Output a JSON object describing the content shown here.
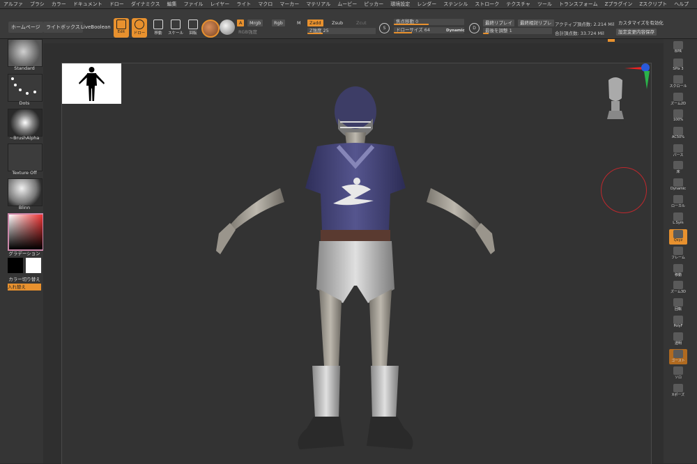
{
  "menu": [
    "アルファ",
    "ブラシ",
    "カラー",
    "ドキュメント",
    "ドロー",
    "ダイナミクス",
    "編集",
    "ファイル",
    "レイヤー",
    "ライト",
    "マクロ",
    "マーカー",
    "マテリアル",
    "ムービー",
    "ピッカー",
    "環境設定",
    "レンダー",
    "ステンシル",
    "ストローク",
    "テクスチャ",
    "ツール",
    "トランスフォーム",
    "Zプラグイン",
    "Zスクリプト",
    "ヘルプ"
  ],
  "shelf": {
    "home": "ホームページ",
    "lightbox": "ライトボックス",
    "liveboolean": "LiveBoolean"
  },
  "tools": {
    "edit": "Edit",
    "draw": "ドロー",
    "move": "移動",
    "scale": "スケール",
    "rotate": "回転"
  },
  "material_mode": {
    "a": "A",
    "mrgb": "Mrgb",
    "rgb": "Rgb",
    "m": "M",
    "rgb_intensity": "RGB強度"
  },
  "z_mode": {
    "zadd": "Zadd",
    "zsub": "Zsub",
    "zcut": "Zcut",
    "z_intensity": "Z強度 25"
  },
  "focal": {
    "label": "焦点移動 0"
  },
  "draw_size": {
    "label": "ドローサイズ 64",
    "dynamic": "Dynamic"
  },
  "s_label": "S",
  "d_label": "D",
  "replay": {
    "last": "最終リプレイ",
    "last_rel": "最終相対リプレ",
    "adjust": "最後を調整 1"
  },
  "stats": {
    "active": "アクティブ頂点数: 2.214 Mil",
    "total": "合計頂点数: 33.724 Mil"
  },
  "customize": {
    "enable": "カスタマイズを有効化",
    "save": "設定変更内容保存"
  },
  "left": {
    "brush": "Standard",
    "stroke": "Dots",
    "alpha": "~BrushAlpha",
    "texture": "Texture Off",
    "material": "Blinn",
    "gradient": "グラデーション",
    "switch": "カラー切り替え",
    "swap": "入れ替え"
  },
  "right": [
    {
      "name": "bpr-button",
      "label": "BPR"
    },
    {
      "name": "spix-button",
      "label": "SPix 3"
    },
    {
      "name": "scroll-button",
      "label": "スクロール"
    },
    {
      "name": "zoom2d-button",
      "label": "ズーム2D"
    },
    {
      "name": "zoom100-button",
      "label": "100%"
    },
    {
      "name": "ac50-button",
      "label": "AC50%"
    },
    {
      "name": "perspective-button",
      "label": "パース"
    },
    {
      "name": "floor-button",
      "label": "床"
    },
    {
      "name": "dynamic-button",
      "label": "Dynamic"
    },
    {
      "name": "local-button",
      "label": "ローカル"
    },
    {
      "name": "lsym-button",
      "label": "L.Sym"
    },
    {
      "name": "xyz-button",
      "label": "Qxyz"
    },
    {
      "name": "frame-button",
      "label": "フレーム"
    },
    {
      "name": "move-button",
      "label": "移動"
    },
    {
      "name": "zoom3d-button",
      "label": "ズーム3D"
    },
    {
      "name": "rotate-button",
      "label": "回転"
    },
    {
      "name": "polyf-button",
      "label": "PolyF"
    },
    {
      "name": "transp-button",
      "label": "透明"
    },
    {
      "name": "ghost-button",
      "label": "ゴースト"
    },
    {
      "name": "solo-button",
      "label": "ソロ"
    },
    {
      "name": "xpose-button",
      "label": "Xポーズ"
    }
  ],
  "colors": {
    "accent": "#e8912e",
    "panel": "#3a3a3a",
    "canvas": "#333333",
    "brush_ring": "#c0282d"
  }
}
